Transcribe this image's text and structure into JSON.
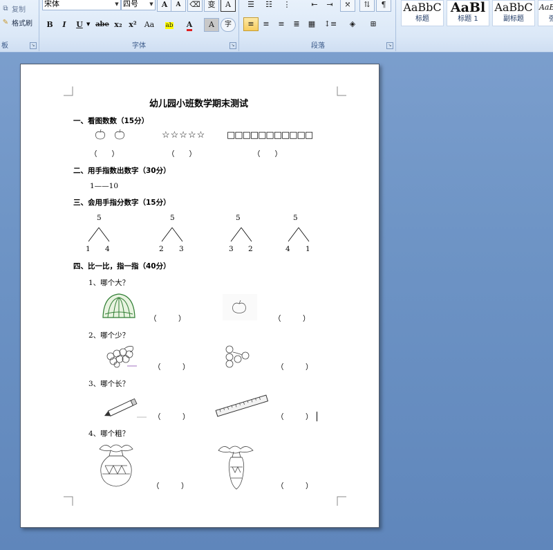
{
  "ribbon": {
    "clipboard": {
      "copy_label": "复制",
      "format_painter_label": "格式刷",
      "group_label": "板"
    },
    "font": {
      "group_label": "字体",
      "font_name": "宋体",
      "font_size": "四号",
      "grow_label": "A",
      "shrink_label": "A",
      "change_case_label": "变",
      "border_label": "A",
      "bold_label": "B",
      "italic_label": "I",
      "underline_label": "U",
      "strike_label": "abe",
      "subscript_label": "x₂",
      "superscript_label": "x²",
      "case_label": "Aa",
      "highlight_label": "ab",
      "color_label": "A",
      "shade_label": "A",
      "enclose_label": "字"
    },
    "paragraph": {
      "group_label": "段落"
    },
    "styles": [
      {
        "sample": "AaBbC",
        "name": "标题"
      },
      {
        "sample": "AaBl",
        "name": "标题 1"
      },
      {
        "sample": "AaBbC",
        "name": "副标题"
      },
      {
        "sample": "AaBbC",
        "name": "强"
      }
    ]
  },
  "document": {
    "title": "幼儿园小班数学期末测试",
    "section1": {
      "heading": "一、看图数数（15分）",
      "stars": "☆☆☆☆☆",
      "squares": "□□□□□□□□□□□",
      "blank": "（　　）"
    },
    "section2": {
      "heading": "二、用手指数出数字（30分）",
      "range": "1——10"
    },
    "section3": {
      "heading": "三、会用手指分数字（15分）",
      "trees": [
        {
          "top": "5",
          "left": "1",
          "right": "4"
        },
        {
          "top": "5",
          "left": "2",
          "right": "3"
        },
        {
          "top": "5",
          "left": "3",
          "right": "2"
        },
        {
          "top": "5",
          "left": "4",
          "right": "1"
        }
      ]
    },
    "section4": {
      "heading": "四、比一比，指一指（40分）",
      "q1": "1、哪个大？",
      "q2": "2、哪个少？",
      "q3": "3、哪个长？",
      "q4": "4、哪个粗？",
      "blank": "（　　　）"
    }
  }
}
